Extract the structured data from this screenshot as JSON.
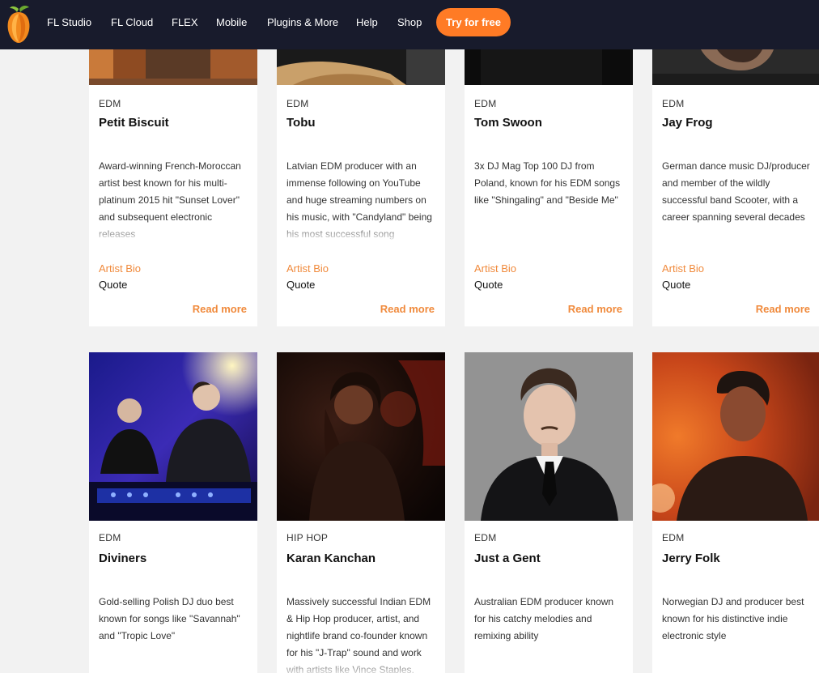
{
  "nav": {
    "logo_icon": "fl-studio-fruit-logo",
    "items": [
      "FL Studio",
      "FL Cloud",
      "FLEX",
      "Mobile",
      "Plugins & More",
      "Help",
      "Shop"
    ],
    "cta": "Try for free",
    "accent": "#ff7b25",
    "background": "#181b2c"
  },
  "cards": [
    {
      "genre": "EDM",
      "name": "Petit Biscuit",
      "description": "Award-winning French-Moroccan artist best known for his multi-platinum 2015 hit \"Sunset Lover\" and subsequent electronic releases",
      "bio_label": "Artist Bio",
      "quote_label": "Quote",
      "read_more": "Read more"
    },
    {
      "genre": "EDM",
      "name": "Tobu",
      "description": "Latvian EDM producer with an immense following on YouTube and huge streaming numbers on his music, with \"Candyland\" being his most successful song",
      "bio_label": "Artist Bio",
      "quote_label": "Quote",
      "read_more": "Read more"
    },
    {
      "genre": "EDM",
      "name": "Tom Swoon",
      "description": "3x DJ Mag Top 100 DJ from Poland, known for his EDM songs like \"Shingaling\" and \"Beside Me\"",
      "bio_label": "Artist Bio",
      "quote_label": "Quote",
      "read_more": "Read more"
    },
    {
      "genre": "EDM",
      "name": "Jay Frog",
      "description": "German dance music DJ/producer and member of the wildly successful band Scooter, with a career spanning several decades",
      "bio_label": "Artist Bio",
      "quote_label": "Quote",
      "read_more": "Read more"
    },
    {
      "genre": "EDM",
      "name": "Diviners",
      "description": "Gold-selling Polish DJ duo best known for songs like \"Savannah\" and \"Tropic Love\""
    },
    {
      "genre": "HIP HOP",
      "name": "Karan Kanchan",
      "description": "Massively successful Indian EDM & Hip Hop producer, artist, and nightlife brand co-founder known for his \"J-Trap\" sound and work with artists like Vince Staples,"
    },
    {
      "genre": "EDM",
      "name": "Just a Gent",
      "description": "Australian EDM producer known for his catchy melodies and remixing ability"
    },
    {
      "genre": "EDM",
      "name": "Jerry Folk",
      "description": "Norwegian DJ and producer best known for his distinctive indie electronic style"
    }
  ],
  "link_color": "#f08a3c"
}
